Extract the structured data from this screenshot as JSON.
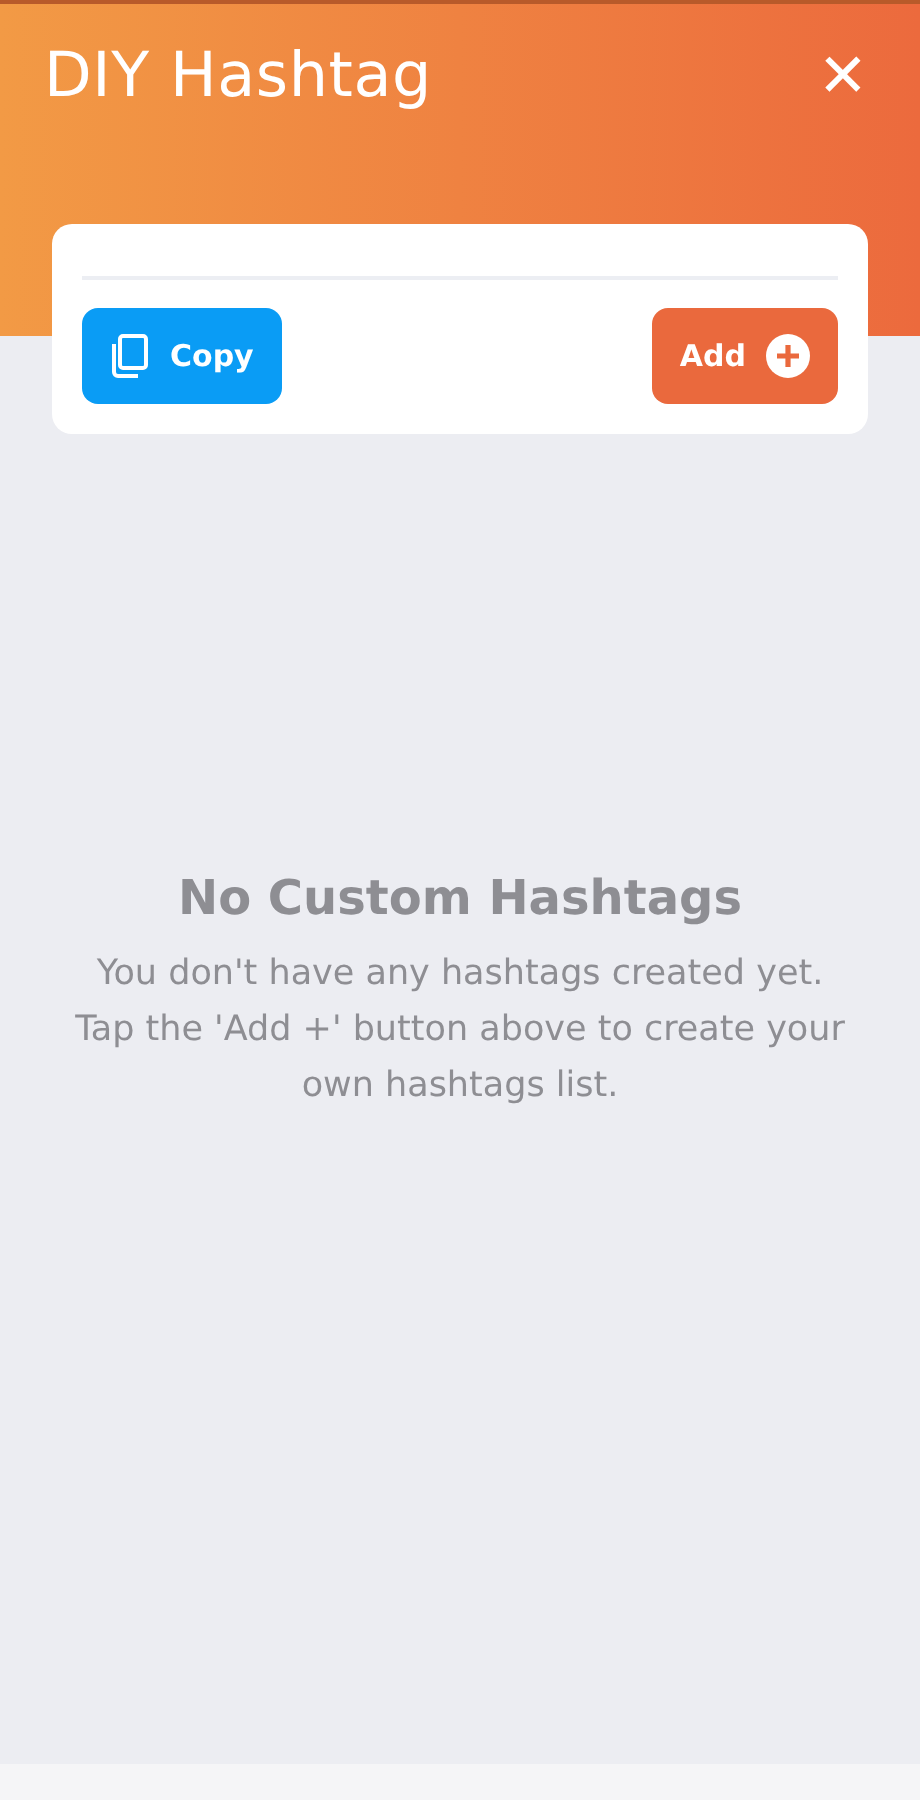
{
  "header": {
    "title": "DIY Hashtag",
    "close_icon": "✕"
  },
  "card": {
    "buttons": [
      {
        "kind": "copy",
        "label": "Copy"
      },
      {
        "kind": "add",
        "label": "Add"
      }
    ]
  },
  "empty_state": {
    "title": "No Custom Hashtags",
    "message": "You don't have any hashtags created yet. Tap the 'Add +' button above to create your own hashtags list."
  }
}
